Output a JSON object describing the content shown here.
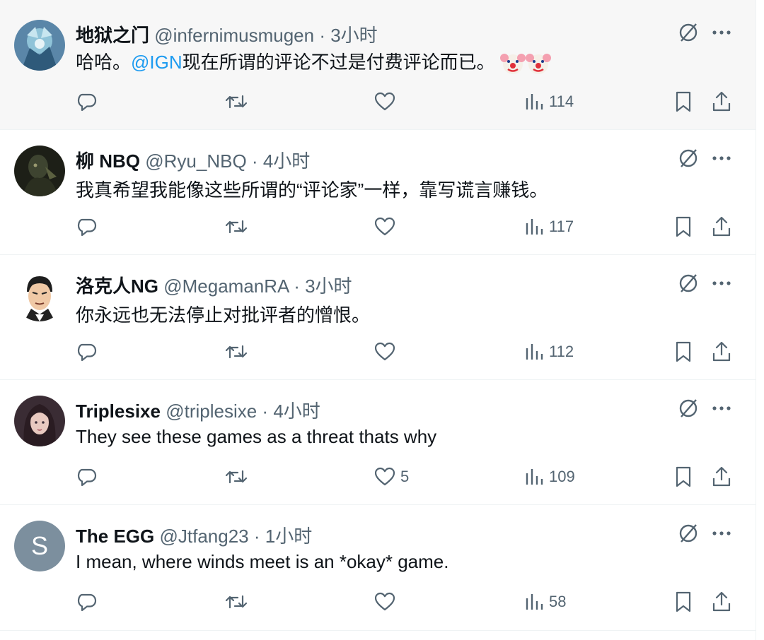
{
  "colors": {
    "link": "#1d9bf0",
    "muted": "#536471",
    "text": "#0f1419"
  },
  "tweets": [
    {
      "name": "地狱之门",
      "handle": "@infernimusmugen",
      "sep": "·",
      "time": "3小时",
      "body_pre": "哈哈。",
      "mention": "@IGN",
      "body_post": "现在所谓的评论不过是付费评论而已。",
      "emoji": "clown-face",
      "likes": "",
      "views": "114"
    },
    {
      "name": "柳 NBQ",
      "handle": "@Ryu_NBQ",
      "sep": "·",
      "time": "4小时",
      "body": "我真希望我能像这些所谓的“评论家”一样，靠写谎言赚钱。",
      "likes": "",
      "views": "117"
    },
    {
      "name": "洛克人NG",
      "handle": "@MegamanRA",
      "sep": "·",
      "time": "3小时",
      "body": "你永远也无法停止对批评者的憎恨。",
      "likes": "",
      "views": "112"
    },
    {
      "name": "Triplesixe",
      "handle": "@triplesixe",
      "sep": "·",
      "time": "4小时",
      "body": "They see these games as a threat thats why",
      "likes": "5",
      "views": "109"
    },
    {
      "name": "The EGG",
      "handle": "@Jtfang23",
      "sep": "·",
      "time": "1小时",
      "body": "I mean, where winds meet is an *okay* game.",
      "likes": "",
      "views": "58",
      "avatar_letter": "S"
    }
  ]
}
